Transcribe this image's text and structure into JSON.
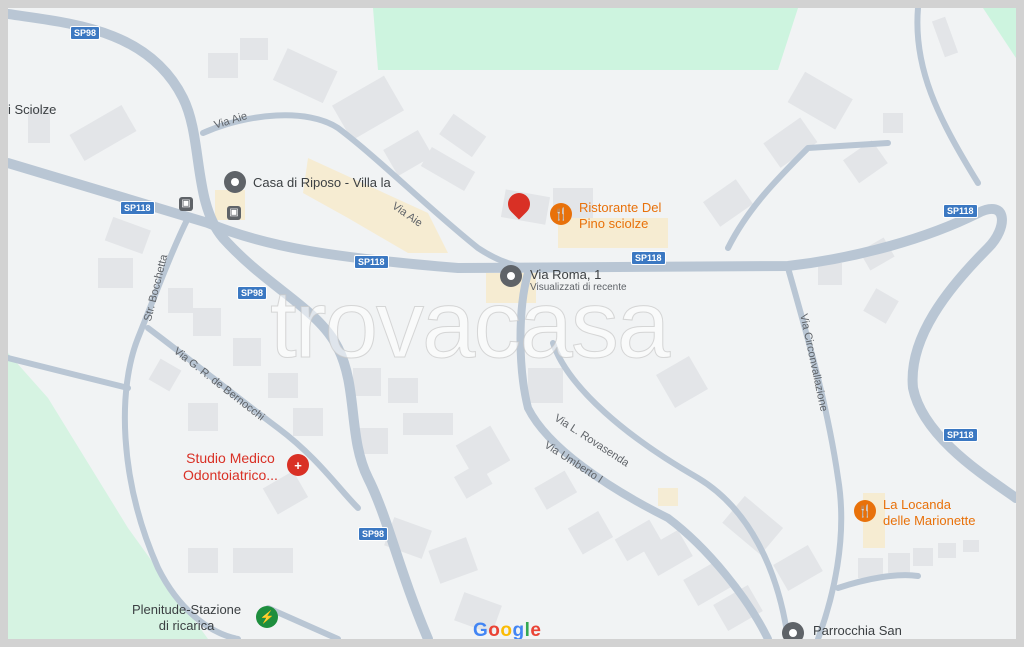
{
  "map": {
    "places": {
      "sciolze_partial": "i Sciolze",
      "casa_riposo": "Casa di Riposo - Villa la",
      "via_roma": "Via Roma, 1",
      "via_roma_sub": "Visualizzati di recente",
      "ristorante_line1": "Ristorante Del",
      "ristorante_line2": "Pino sciolze",
      "studio_line1": "Studio Medico",
      "studio_line2": "Odontoiatrico...",
      "locanda_line1": "La Locanda",
      "locanda_line2": "delle Marionette",
      "plenitude_line1": "Plenitude-Stazione",
      "plenitude_line2": "di ricarica",
      "parrocchia": "Parrocchia San"
    },
    "streets": {
      "via_aie_1": "Via Aie",
      "via_aie_2": "Via Aie",
      "bocchetta": "Str. Bocchetta",
      "bernocchi": "Via G. R. de Bernocchi",
      "rovasenda": "Via L. Rovasenda",
      "umberto": "Via Umberto I",
      "circonvallazione": "Via Circonvallazione"
    },
    "shields": {
      "sp98_top": "SP98",
      "sp118_left": "SP118",
      "sp118_mid": "SP118",
      "sp98_mid": "SP98",
      "sp118_right_mid": "SP118",
      "sp118_right": "SP118",
      "sp118_lower_right": "SP118",
      "sp98_bottom": "SP98"
    },
    "watermark": "trovacasa",
    "attribution": "Google",
    "colors": {
      "road": "#b8c7d6",
      "park": "#cdf4df",
      "building": "#e4e6ea",
      "poi_orange": "#e8710a",
      "poi_red": "#d93025",
      "route_shield": "#3b78c2"
    }
  }
}
